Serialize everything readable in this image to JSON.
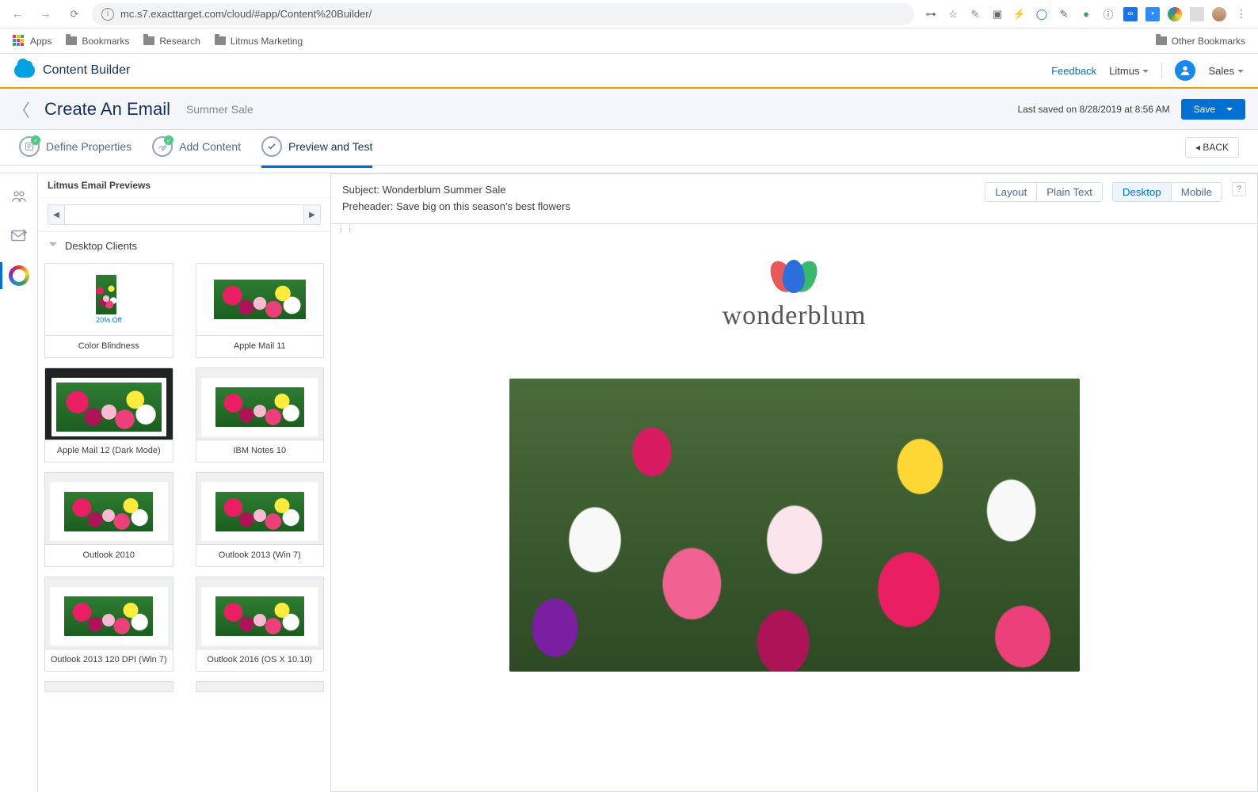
{
  "browser": {
    "url": "mc.s7.exacttarget.com/cloud/#app/Content%20Builder/",
    "bookmarks": [
      "Apps",
      "Bookmarks",
      "Research",
      "Litmus Marketing"
    ],
    "other_bookmarks": "Other Bookmarks"
  },
  "app": {
    "title": "Content Builder",
    "feedback": "Feedback",
    "workspace": "Litmus",
    "user_menu": "Sales"
  },
  "header": {
    "title": "Create An Email",
    "subtitle": "Summer Sale",
    "last_saved": "Last saved on 8/28/2019 at 8:56 AM",
    "save": "Save"
  },
  "steps": {
    "define": "Define Properties",
    "add": "Add Content",
    "preview": "Preview and Test",
    "back": "BACK"
  },
  "panel": {
    "title": "Litmus Email Previews",
    "section": "Desktop Clients",
    "thumbs": [
      {
        "label": "Color Blindness",
        "offer": "20% Off"
      },
      {
        "label": "Apple Mail 11"
      },
      {
        "label": "Apple Mail 12 (Dark Mode)"
      },
      {
        "label": "IBM Notes 10"
      },
      {
        "label": "Outlook 2010"
      },
      {
        "label": "Outlook 2013 (Win 7)"
      },
      {
        "label": "Outlook 2013 120 DPI (Win 7)"
      },
      {
        "label": "Outlook 2016 (OS X 10.10)"
      }
    ]
  },
  "preview": {
    "subject_label": "Subject:",
    "subject": "Wonderblum Summer Sale",
    "preheader_label": "Preheader:",
    "preheader": "Save big on this season's best flowers",
    "toggles": {
      "layout": "Layout",
      "plain": "Plain Text",
      "desktop": "Desktop",
      "mobile": "Mobile"
    },
    "brand": "wonderblum"
  }
}
